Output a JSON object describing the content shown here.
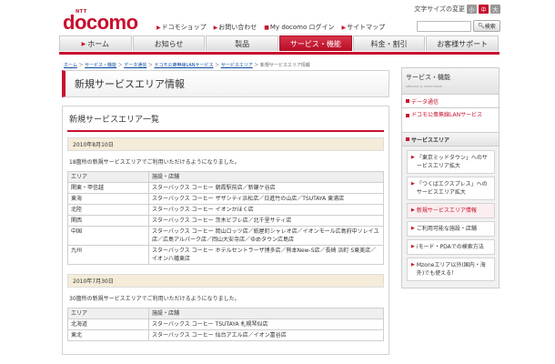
{
  "header": {
    "logo_small": "NTT",
    "logo": "docomo",
    "font_size_label": "文字サイズの変更",
    "font_size_buttons": [
      "小",
      "中",
      "大"
    ],
    "search_button": "検索",
    "utility_links": [
      "ドコモショップ",
      "お問い合わせ",
      "My docomo ログイン",
      "サイトマップ"
    ]
  },
  "nav": {
    "tabs": [
      "ホーム",
      "お知らせ",
      "製品",
      "サービス・機能",
      "料金・割引",
      "お客様サポート"
    ],
    "active_index": 3
  },
  "breadcrumb": [
    "ホーム",
    "サービス・機能",
    "データ通信",
    "ドコモ公衆無線LANサービス",
    "サービスエリア",
    "新規サービスエリア情報"
  ],
  "main": {
    "page_title": "新規サービスエリア情報",
    "panel_title": "新規サービスエリア一覧",
    "sections": [
      {
        "date": "2010年8月10日",
        "notice": "18箇所の新規サービスエリアでご利用いただけるようになりました。",
        "headers": [
          "エリア",
          "施設・店舗"
        ],
        "rows": [
          [
            "関東・甲信越",
            "スターバックス コーヒー 朝霞駅前店／新鎌ケ谷店"
          ],
          [
            "東海",
            "スターバックス コーヒー ザザシティ浜松店／日進竹の山店／TSUTAYA 東浦店"
          ],
          [
            "北陸",
            "スターバックス コーヒー イオンかほく店"
          ],
          [
            "関西",
            "スターバックス コーヒー 茨木ビブレ店／北千里サティ店"
          ],
          [
            "中国",
            "スターバックス コーヒー 岡山ロッツ店／紙屋町シャレオ店／イオンモール広島府中ソレイユ店／広島アルパーク店／岡山大安寺店／ゆめタウン広島店"
          ],
          [
            "九州",
            "スターバックス コーヒー ホテルセントラーザ博多店／熊本New-S店／長崎 浜町 S東美店／イオン八幡東店"
          ]
        ]
      },
      {
        "date": "2010年7月30日",
        "notice": "30箇所の新規サービスエリアでご利用いただけるようになりました。",
        "headers": [
          "エリア",
          "施設・店舗"
        ],
        "rows": [
          [
            "北海道",
            "スターバックス コーヒー TSUTAYA 札幌琴似店"
          ],
          [
            "東北",
            "スターバックス コーヒー 仙台アエル店／イオン富谷店"
          ]
        ]
      }
    ]
  },
  "sidebar": {
    "title": "サービス・機能",
    "subtitle": "SERVICE & FUNCTIONS",
    "link_data": "データ通信",
    "link_lan": "ドコモ公衆無線LANサービス",
    "current_section": "サービスエリア",
    "items": [
      "「東京ミッドタウン」へのサービスエリア拡大",
      "「つくばエクスプレス」へのサービスエリア拡大",
      "新規サービスエリア情報",
      "ご利用可能な施設・店舗",
      "iモード・PDAでの検索方法",
      "Mzoneエリア以外(国内・海外)でも使える！"
    ],
    "active_item_index": 2
  },
  "colors": {
    "brand": "#c8102e",
    "date_bar": "#f4ecd9"
  }
}
